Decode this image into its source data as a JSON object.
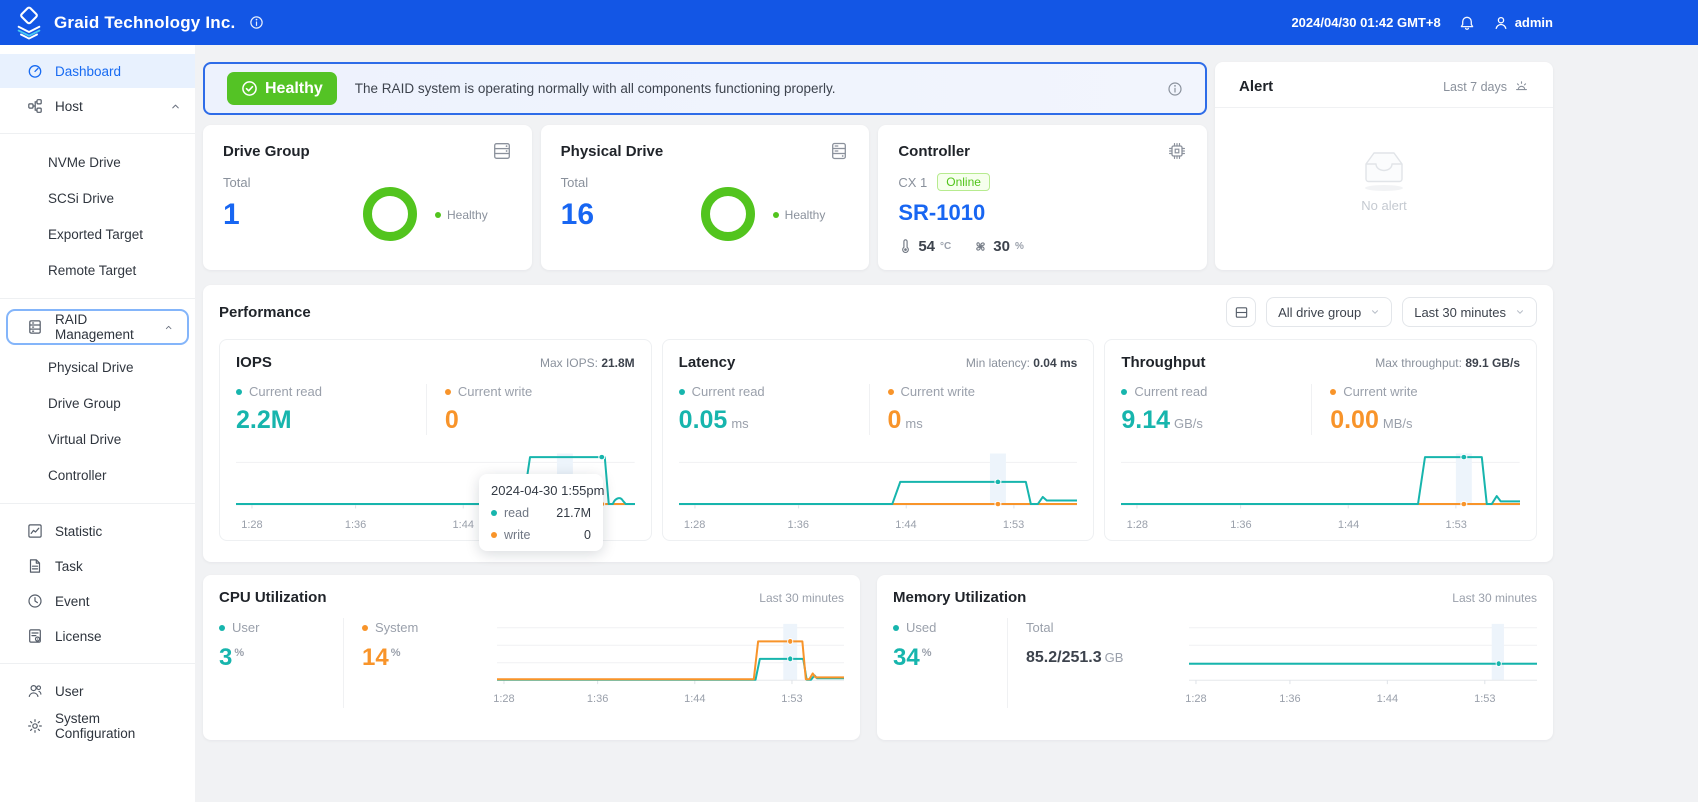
{
  "topbar": {
    "brand": "Graid Technology Inc.",
    "datetime": "2024/04/30 01:42 GMT+8",
    "user": "admin"
  },
  "sidebar": {
    "dashboard": "Dashboard",
    "host": "Host",
    "host_children": [
      "NVMe Drive",
      "SCSi Drive",
      "Exported Target",
      "Remote Target"
    ],
    "raid": "RAID Management",
    "raid_children": [
      "Physical Drive",
      "Drive Group",
      "Virtual Drive",
      "Controller"
    ],
    "statistic": "Statistic",
    "task": "Task",
    "event": "Event",
    "license": "License",
    "user": "User",
    "system_configuration": "System Configuration"
  },
  "banner": {
    "status": "Healthy",
    "message": "The RAID system is operating normally with all components functioning properly."
  },
  "alert": {
    "title": "Alert",
    "range": "Last 7 days",
    "empty": "No alert"
  },
  "cards": {
    "drive_group": {
      "title": "Drive Group",
      "total_label": "Total",
      "total": "1",
      "legend": "Healthy"
    },
    "physical_drive": {
      "title": "Physical Drive",
      "total_label": "Total",
      "total": "16",
      "legend": "Healthy"
    },
    "controller": {
      "title": "Controller",
      "name": "CX 1",
      "status": "Online",
      "model": "SR-1010",
      "temperature": "54",
      "temperature_unit": "°C",
      "fan_speed": "30",
      "fan_unit": "%"
    }
  },
  "performance": {
    "title": "Performance",
    "drive_group_filter": "All drive group",
    "time_filter": "Last 30 minutes",
    "x_ticks": [
      "1:28",
      "1:36",
      "1:44",
      "1:53"
    ],
    "iops": {
      "title": "IOPS",
      "max_label": "Max IOPS:",
      "max_value": "21.8M",
      "read_label": "Current read",
      "read_value": "2.2M",
      "write_label": "Current write",
      "write_value": "0"
    },
    "latency": {
      "title": "Latency",
      "max_label": "Min latency:",
      "max_value": "0.04 ms",
      "read_label": "Current read",
      "read_value": "0.05",
      "read_unit": "ms",
      "write_label": "Current write",
      "write_value": "0",
      "write_unit": "ms"
    },
    "throughput": {
      "title": "Throughput",
      "max_label": "Max throughput:",
      "max_value": "89.1 GB/s",
      "read_label": "Current read",
      "read_value": "9.14",
      "read_unit": "GB/s",
      "write_label": "Current write",
      "write_value": "0.00",
      "write_unit": "MB/s"
    },
    "tooltip": {
      "title": "2024-04-30 1:55pm",
      "read_label": "read",
      "read_value": "21.7M",
      "write_label": "write",
      "write_value": "0"
    }
  },
  "cpu": {
    "title": "CPU Utilization",
    "range": "Last 30 minutes",
    "user_label": "User",
    "user_value": "3",
    "user_unit": "%",
    "system_label": "System",
    "system_value": "14",
    "system_unit": "%"
  },
  "memory": {
    "title": "Memory Utilization",
    "range": "Last 30 minutes",
    "used_label": "Used",
    "used_value": "34",
    "used_unit": "%",
    "total_label": "Total",
    "total_value": "85.2/251.3",
    "total_unit": "GB"
  },
  "colors": {
    "topbar_blue": "#1356e5",
    "accent_blue": "#1866f2",
    "teal": "#17b5ad",
    "orange": "#f8942a",
    "green": "#52c41e",
    "banner_border": "#2e6ce8"
  },
  "chart_data": [
    {
      "type": "line",
      "title": "IOPS",
      "x_ticks": [
        "1:28",
        "1:36",
        "1:44",
        "1:53"
      ],
      "max": "21.8M",
      "series": [
        {
          "name": "read",
          "color": "#17b5ad",
          "current": "2.2M",
          "unit": "IOPS",
          "points_pct_time_value": [
            [
              0,
              0
            ],
            [
              72,
              0
            ],
            [
              74,
              21.7
            ],
            [
              92,
              21.7
            ],
            [
              94,
              0
            ],
            [
              96,
              1.8
            ],
            [
              100,
              0.6
            ]
          ]
        },
        {
          "name": "write",
          "color": "#f8942a",
          "current": "0",
          "unit": "IOPS",
          "points_pct_time_value": [
            [
              0,
              0
            ],
            [
              100,
              0
            ]
          ]
        }
      ]
    },
    {
      "type": "line",
      "title": "Latency",
      "x_ticks": [
        "1:28",
        "1:36",
        "1:44",
        "1:53"
      ],
      "min": "0.04 ms",
      "series": [
        {
          "name": "read",
          "color": "#17b5ad",
          "current": "0.05 ms",
          "unit": "ms",
          "points_pct_time_value": [
            [
              0,
              0
            ],
            [
              54,
              0
            ],
            [
              56,
              0.05
            ],
            [
              87,
              0.05
            ],
            [
              89,
              0
            ],
            [
              92,
              0.02
            ],
            [
              100,
              0.01
            ]
          ]
        },
        {
          "name": "write",
          "color": "#f8942a",
          "current": "0 ms",
          "unit": "ms",
          "points_pct_time_value": [
            [
              0,
              0
            ],
            [
              100,
              0
            ]
          ]
        }
      ]
    },
    {
      "type": "line",
      "title": "Throughput",
      "x_ticks": [
        "1:28",
        "1:36",
        "1:44",
        "1:53"
      ],
      "max": "89.1 GB/s",
      "series": [
        {
          "name": "read",
          "color": "#17b5ad",
          "current": "9.14 GB/s",
          "unit": "GB/s",
          "points_pct_time_value": [
            [
              0,
              0
            ],
            [
              74,
              0
            ],
            [
              76,
              89.1
            ],
            [
              91,
              89.1
            ],
            [
              93,
              0
            ],
            [
              95,
              9
            ],
            [
              100,
              2
            ]
          ]
        },
        {
          "name": "write",
          "color": "#f8942a",
          "current": "0.00 MB/s",
          "unit": "MB/s",
          "points_pct_time_value": [
            [
              0,
              0
            ],
            [
              100,
              0
            ]
          ]
        }
      ]
    },
    {
      "type": "line",
      "title": "CPU Utilization",
      "x_ticks": [
        "1:28",
        "1:36",
        "1:44",
        "1:53"
      ],
      "series": [
        {
          "name": "User",
          "color": "#17b5ad",
          "current": "3%",
          "points_pct_time_value": [
            [
              0,
              1
            ],
            [
              74,
              1
            ],
            [
              76,
              15
            ],
            [
              88,
              15
            ],
            [
              90,
              2
            ],
            [
              93,
              3
            ],
            [
              100,
              3
            ]
          ]
        },
        {
          "name": "System",
          "color": "#f8942a",
          "current": "14%",
          "points_pct_time_value": [
            [
              0,
              2
            ],
            [
              74,
              2
            ],
            [
              76,
              30
            ],
            [
              88,
              30
            ],
            [
              90,
              4
            ],
            [
              93,
              14
            ],
            [
              100,
              14
            ]
          ]
        }
      ]
    },
    {
      "type": "line",
      "title": "Memory Utilization",
      "x_ticks": [
        "1:28",
        "1:36",
        "1:44",
        "1:53"
      ],
      "series": [
        {
          "name": "Used",
          "color": "#17b5ad",
          "current": "34%",
          "points_pct_time_value": [
            [
              0,
              34
            ],
            [
              100,
              34
            ]
          ]
        }
      ]
    }
  ]
}
